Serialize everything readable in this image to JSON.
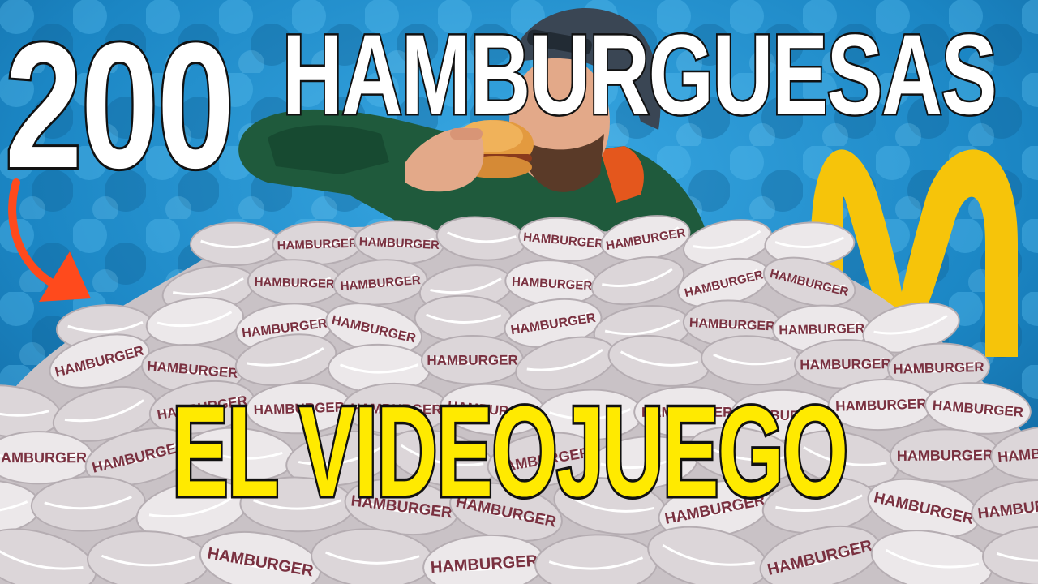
{
  "thumbnail": {
    "title_number": "200",
    "title_word": "HAMBURGUESAS",
    "subtitle": "EL VIDEOJUEGO",
    "wrapper_label": "HAMBURGER"
  },
  "colors": {
    "background": "#1b86c4",
    "title_text": "#ffffff",
    "subtitle_text": "#ffea00",
    "arrow": "#ff4a1c",
    "logo": "#f6c40a",
    "hoodie": "#1f5a3c",
    "wrapper": "#e9e4e6",
    "wrapper_print": "#7a3140"
  },
  "icons": [
    "arrow-icon",
    "golden-arches-logo"
  ]
}
